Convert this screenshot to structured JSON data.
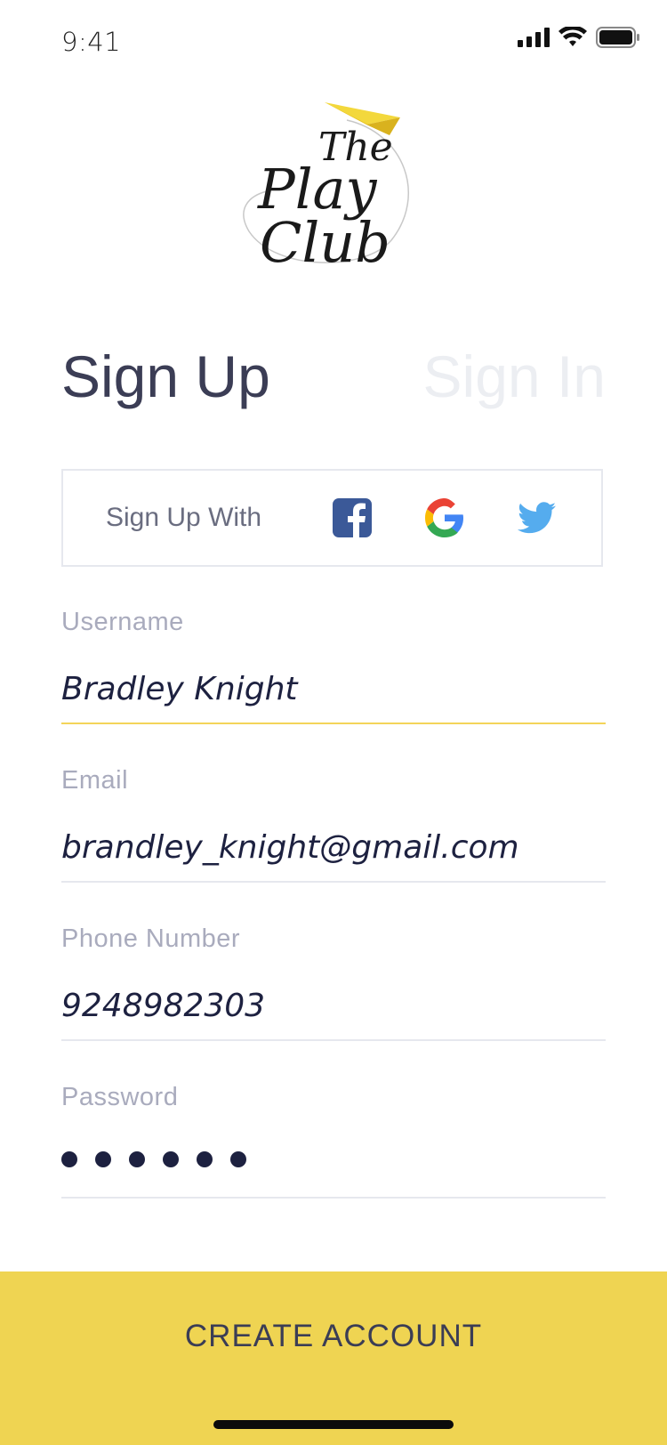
{
  "status_bar": {
    "time": "9:41"
  },
  "logo": {
    "line1": "The",
    "line2": "Play",
    "line3": "Club"
  },
  "tabs": {
    "sign_up": "Sign Up",
    "sign_in": "Sign In"
  },
  "social": {
    "label": "Sign Up With",
    "providers": [
      "facebook-icon",
      "google-icon",
      "twitter-icon"
    ]
  },
  "form": {
    "username": {
      "label": "Username",
      "value": "Bradley Knight"
    },
    "email": {
      "label": "Email",
      "value": "brandley_knight@gmail.com"
    },
    "phone": {
      "label": "Phone Number",
      "value": "9248982303"
    },
    "password": {
      "label": "Password",
      "masked_length": 6
    }
  },
  "cta": {
    "label": "CREATE ACCOUNT"
  },
  "colors": {
    "accent": "#efd452",
    "active_underline": "#f3d459",
    "text_primary": "#3b3d55",
    "label_muted": "#a9abbd",
    "facebook": "#3b5998",
    "twitter": "#55acee"
  }
}
